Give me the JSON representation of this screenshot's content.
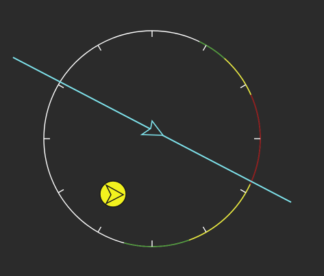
{
  "display": {
    "type": "radar-scope",
    "background": "#2b2b2b"
  },
  "bearing_ring": {
    "color": "#ffffff",
    "tick_count": 12,
    "arc_colors": {
      "green": "#4f9a3a",
      "yellow": "#e8e83a",
      "red": "#8e1d1d"
    }
  },
  "center_target": {
    "icon": "arrowhead-icon",
    "color": "#7fe3ec"
  },
  "track_line": {
    "color": "#7fe3ec"
  },
  "contact": {
    "icon": "play-triangle-icon",
    "fill": "#f2f21e",
    "outline": "#1a1a1a"
  }
}
